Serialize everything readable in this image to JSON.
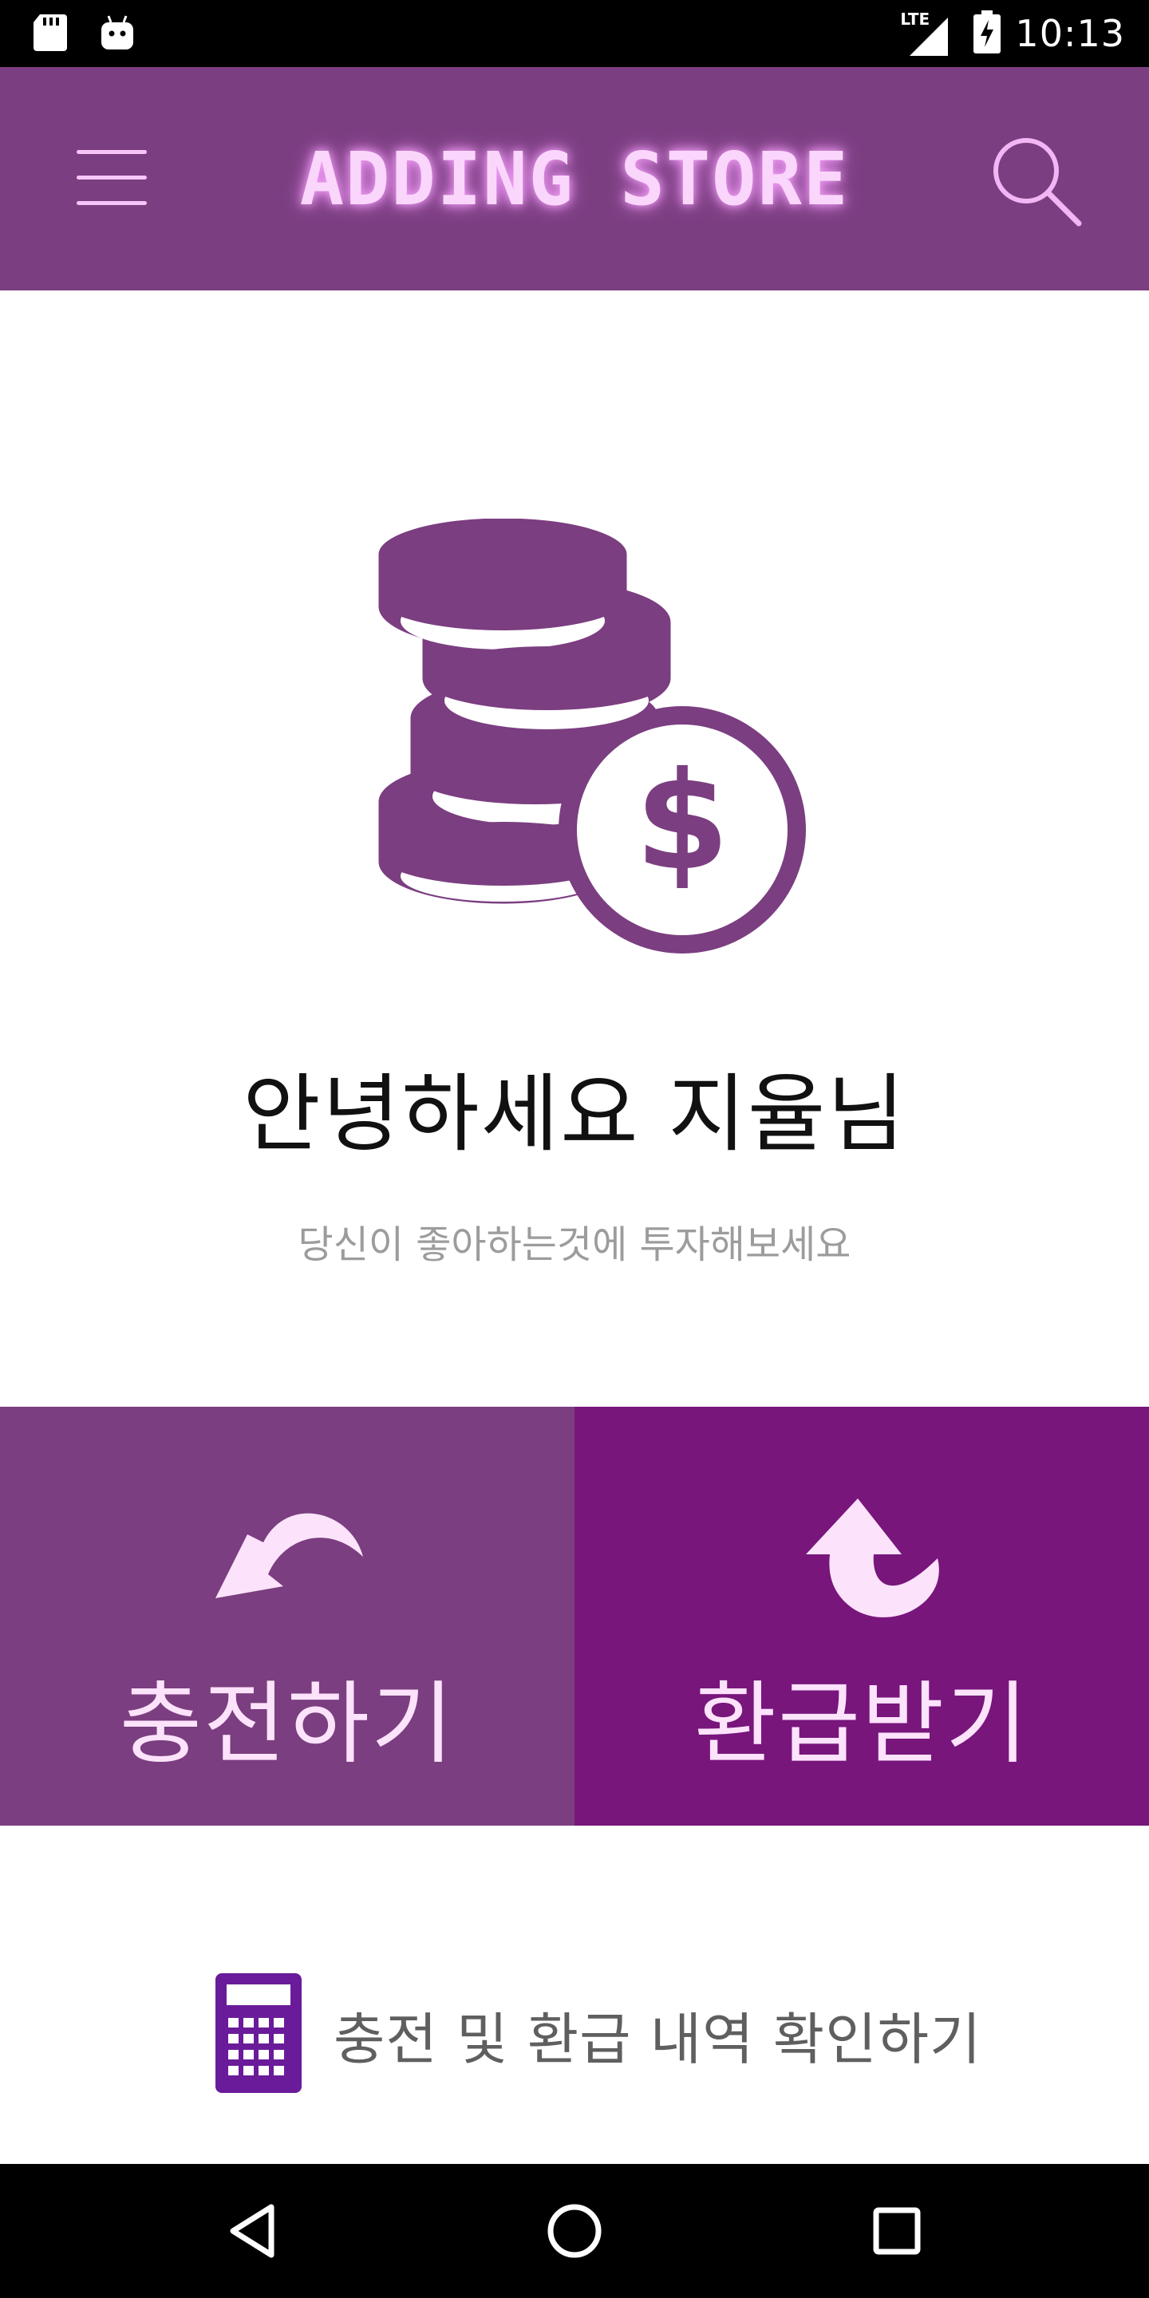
{
  "status_bar": {
    "time": "10:13",
    "network_label": "LTE",
    "icons": [
      "sd-card-icon",
      "android-debug-icon",
      "signal-icon",
      "battery-charging-icon"
    ]
  },
  "app_bar": {
    "title": "ADDING STORE",
    "menu_icon": "hamburger-menu-icon",
    "search_icon": "search-icon"
  },
  "hero": {
    "icon": "coin-stack-dollar-icon",
    "greeting": "안녕하세요 지율님",
    "subtitle": "당신이 좋아하는것에 투자해보세요"
  },
  "actions": {
    "charge_label": "충전하기",
    "refund_label": "환급받기"
  },
  "history": {
    "label": "충전 및 환급 내역 확인하기",
    "icon": "calculator-icon"
  },
  "nav_bar": {
    "icons": [
      "back-icon",
      "home-icon",
      "recents-icon"
    ]
  },
  "colors": {
    "app_bar": "#7b3e80",
    "charge_panel": "#7b3e80",
    "refund_panel": "#78167c",
    "accent_pink": "#fbd6fc",
    "icon_purple": "#7b3e80",
    "calculator_purple": "#6a1b9a"
  }
}
